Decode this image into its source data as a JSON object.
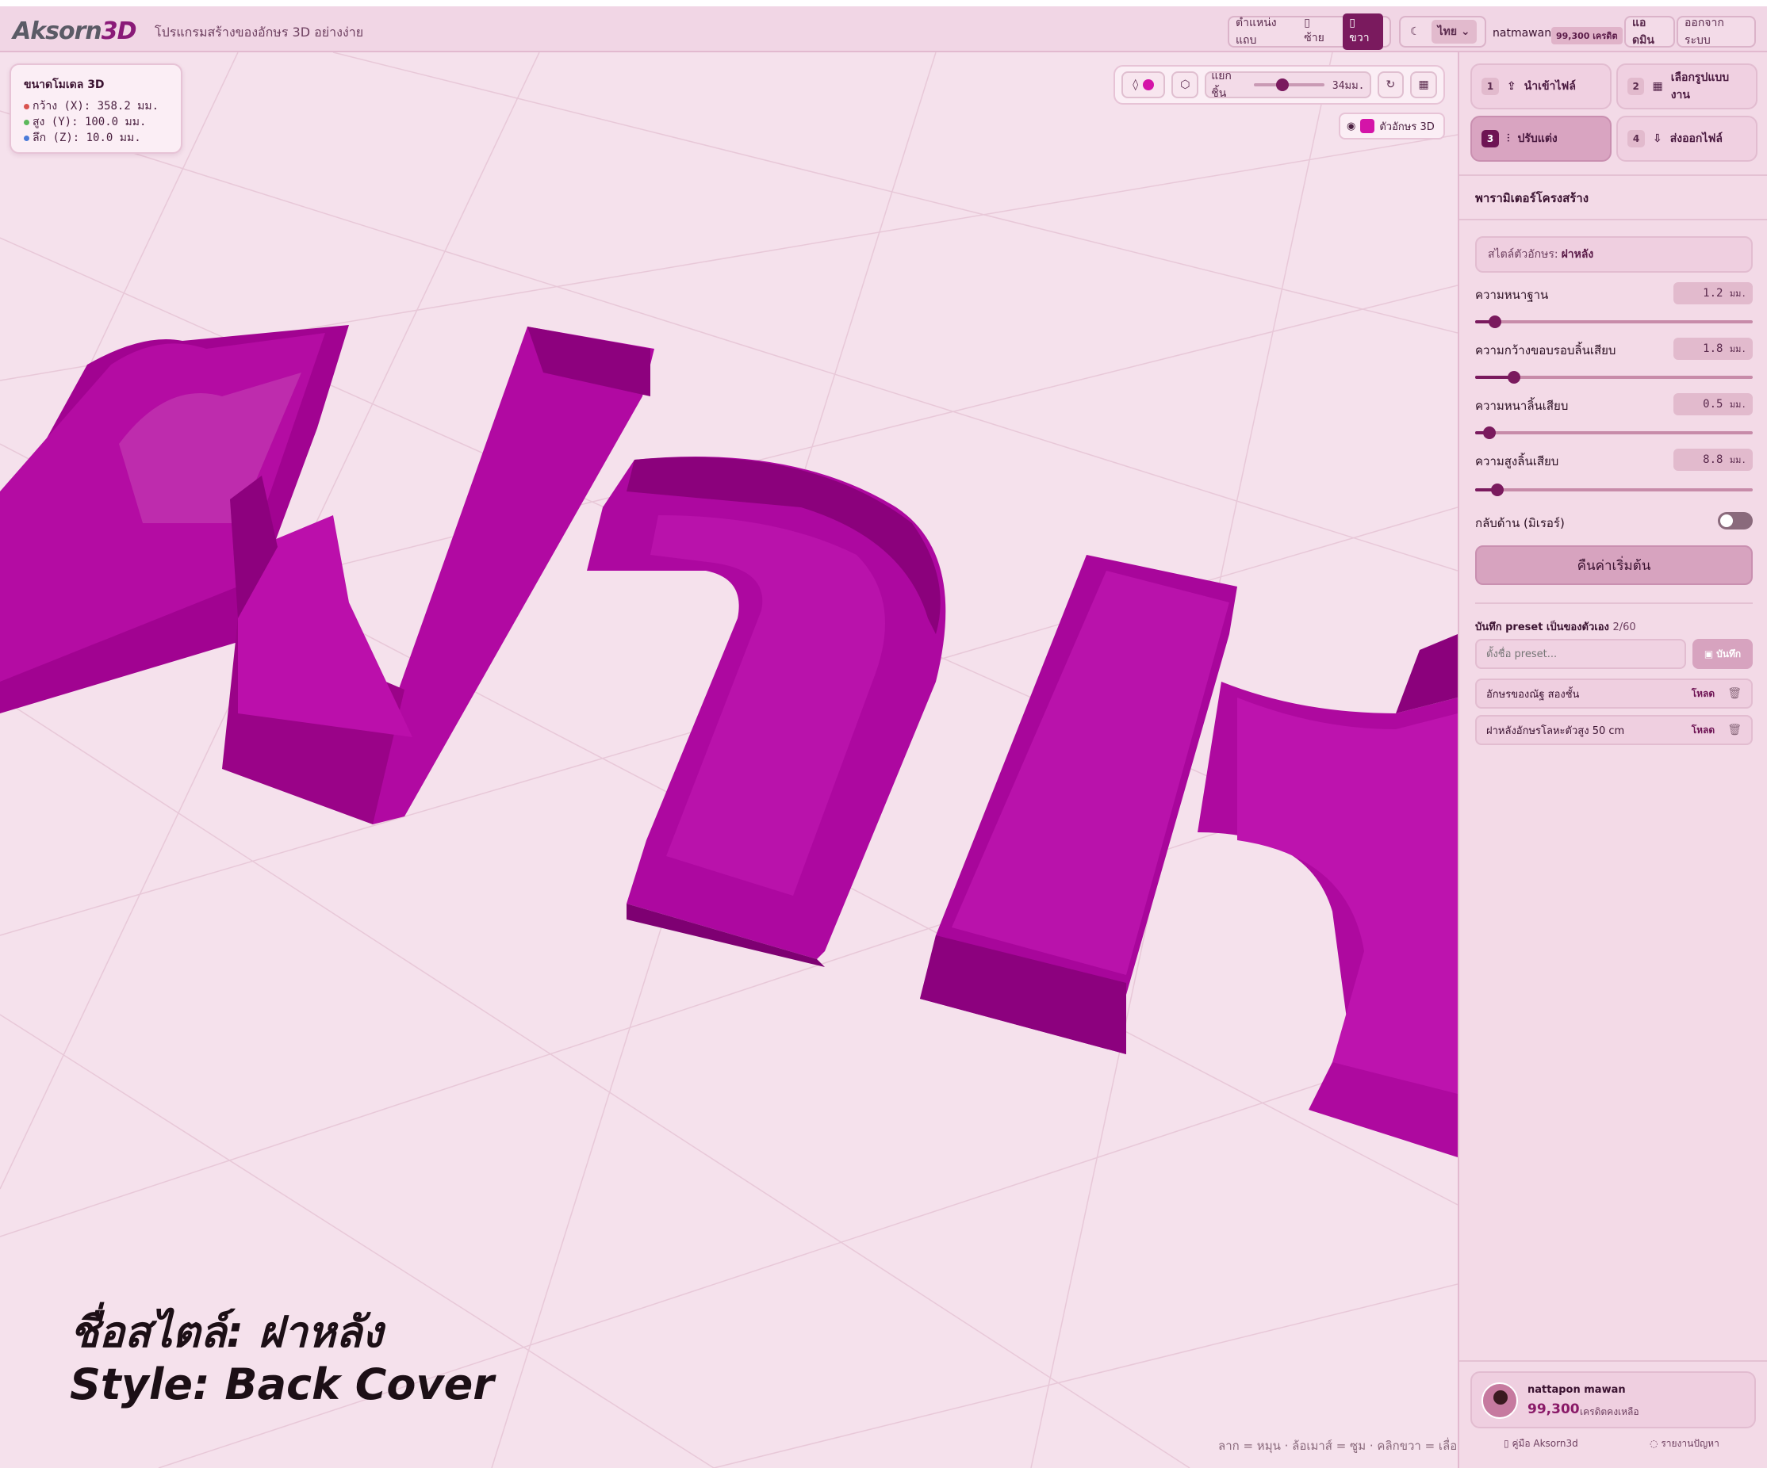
{
  "header": {
    "logo_text": "Aksorn",
    "logo_accent": "3D",
    "tagline": "โปรแกรมสร้างของอักษร 3D อย่างง่าย",
    "panel_position_label": "ตำแหน่งแถบ",
    "panel_left_label": "ซ้าย",
    "panel_right_label": "ขวา",
    "theme_icon": "moon-icon",
    "language": "ไทย",
    "username": "natmawan",
    "credits_badge": "99,300 เครดิต",
    "admin_label": "แอดมิน",
    "logout_label": "ออกจากระบบ"
  },
  "model_dimensions": {
    "title_prefix": "ขนาดโมเดล",
    "title_suffix": "3D",
    "width": "กว้าง (X): 358.2 มม.",
    "height": "สูง (Y): 100.0 มม.",
    "depth": "ลึก (Z): 10.0 มม.",
    "colors": {
      "x": "#d9534f",
      "y": "#5cb85c",
      "z": "#4a7bd9"
    }
  },
  "viewport_tools": {
    "separate_label": "แยกชิ้น",
    "separate_value": "34มม.",
    "separate_level": 0.3,
    "layer_label": "ตัวอักษร 3D",
    "color": "#d414a8"
  },
  "viewport": {
    "caption_line1": "ชื่อสไตล์: ฝาหลัง",
    "caption_line2": "Style: Back Cover",
    "controls_hint": "ลาก = หมุน · ล้อเมาส์ = ซูม · คลิกขวา = เลื่อน"
  },
  "steps": [
    {
      "num": "1",
      "label": "นำเข้าไฟล์",
      "icon": "upload-icon"
    },
    {
      "num": "2",
      "label": "เลือกรูปแบบงาน",
      "icon": "grid-icon"
    },
    {
      "num": "3",
      "label": "ปรับแต่ง",
      "icon": "sliders-icon"
    },
    {
      "num": "4",
      "label": "ส่งออกไฟล์",
      "icon": "download-icon"
    }
  ],
  "params": {
    "section_title": "พารามิเตอร์โครงสร้าง",
    "style_label": "สไตล์ตัวอักษร:",
    "style_value": "ฝาหลัง",
    "items": [
      {
        "label": "ความหนาฐาน",
        "value": "1.2",
        "unit": "มม.",
        "level": 0.07
      },
      {
        "label": "ความกว้างขอบรอบลิ้นเสียบ",
        "value": "1.8",
        "unit": "มม.",
        "level": 0.14
      },
      {
        "label": "ความหนาลิ้นเสียบ",
        "value": "0.5",
        "unit": "มม.",
        "level": 0.05
      },
      {
        "label": "ความสูงลิ้นเสียบ",
        "value": "8.8",
        "unit": "มม.",
        "level": 0.08
      }
    ],
    "mirror_label": "กลับด้าน (มิเรอร์)",
    "reset_label": "คืนค่าเริ่มต้น"
  },
  "presets": {
    "title": "บันทึก preset เป็นของตัวเอง",
    "count": "2/60",
    "placeholder": "ตั้งชื่อ preset...",
    "save_label": "บันทึก",
    "load_label": "โหลด",
    "items": [
      "อักษรของณัฐ สองชั้น",
      "ฝาหลังอักษรโลหะตัวสูง 50 cm"
    ]
  },
  "user": {
    "name": "nattapon mawan",
    "credits": "99,300",
    "credits_label": "เครดิตคงเหลือ"
  },
  "footer": {
    "guide_label": "คู่มือ Aksorn3d",
    "report_label": "รายงานปัญหา"
  }
}
